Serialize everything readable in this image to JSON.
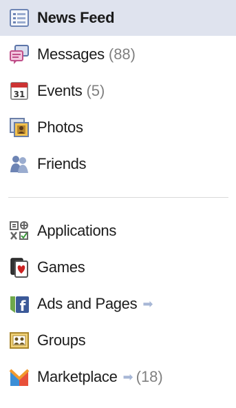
{
  "menu": {
    "news_feed": {
      "label": "News Feed",
      "icon": "news-feed-icon"
    },
    "messages": {
      "label": "Messages",
      "count": "(88)",
      "icon": "messages-icon"
    },
    "events": {
      "label": "Events",
      "count": "(5)",
      "icon": "calendar-icon",
      "icon_text": "31"
    },
    "photos": {
      "label": "Photos",
      "icon": "photos-icon"
    },
    "friends": {
      "label": "Friends",
      "icon": "friends-icon"
    },
    "applications": {
      "label": "Applications",
      "icon": "applications-icon"
    },
    "games": {
      "label": "Games",
      "icon": "games-icon"
    },
    "ads_pages": {
      "label": "Ads and Pages",
      "icon": "facebook-icon",
      "icon_text": "f"
    },
    "groups": {
      "label": "Groups",
      "icon": "groups-icon"
    },
    "marketplace": {
      "label": "Marketplace",
      "count": "(18)",
      "icon": "marketplace-icon"
    }
  },
  "colors": {
    "selected_bg": "#dfe3ee",
    "count": "#808080",
    "arrow": "#a7b7d6",
    "facebook_blue": "#3b5998"
  }
}
